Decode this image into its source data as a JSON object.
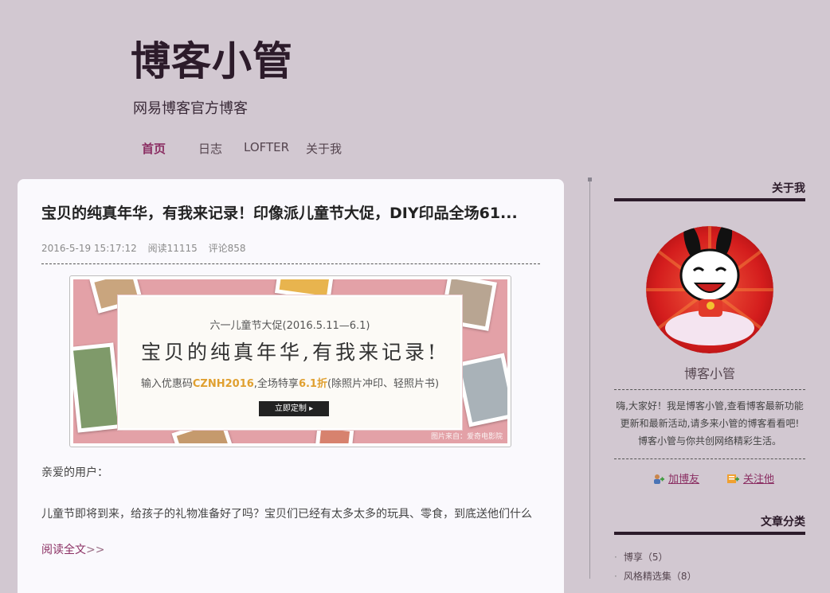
{
  "header": {
    "title": "博客小管",
    "subtitle": "网易博客官方博客"
  },
  "nav": {
    "items": [
      {
        "label": "首页",
        "active": true
      },
      {
        "label": "日志",
        "active": false
      },
      {
        "label": "LOFTER",
        "active": false
      },
      {
        "label": "关于我",
        "active": false
      }
    ]
  },
  "post": {
    "title": "宝贝的纯真年华，有我来记录！印像派儿童节大促，DIY印品全场61...",
    "date": "2016-5-19 15:17:12",
    "reads": "阅读11115",
    "comments": "评论858",
    "greeting": "亲爱的用户：",
    "excerpt": "儿童节即将到来，给孩子的礼物准备好了吗？宝贝们已经有太多太多的玩具、零食，到底送他们什么",
    "read_more": "阅读全文",
    "read_more_arrow": ">>"
  },
  "banner": {
    "subtitle": "六一儿童节大促(2016.5.11—6.1)",
    "headline": "宝贝的纯真年华,有我来记录!",
    "note_prefix": "输入优惠码",
    "code": "CZNH2016",
    "note_mid": ",全场特享",
    "discount": "6.1折",
    "note_suffix": "(除照片冲印、轻照片书)",
    "button": "立即定制 ▸",
    "credit": "图片来自：爱奇电影院",
    "bg_color": "#e3a1a7",
    "highlight_color": "#e0a030"
  },
  "sidebar": {
    "about_heading": "关于我",
    "profile_name": "博客小管",
    "profile_desc_lines": [
      "嗨,大家好！我是博客小管,查看博客最新功能",
      "更新和最新活动,请多来小管的博客看看吧!",
      "博客小管与你共创网络精彩生活。"
    ],
    "add_friend": "加博友",
    "follow": "关注他",
    "categories_heading": "文章分类",
    "categories": [
      {
        "label": "博享（5）"
      },
      {
        "label": "风格精选集（8）"
      }
    ]
  },
  "colors": {
    "background": "#d2c8d1",
    "accent": "#8b2f63",
    "heading": "#2c1b2a",
    "card": "#faf9fd"
  }
}
